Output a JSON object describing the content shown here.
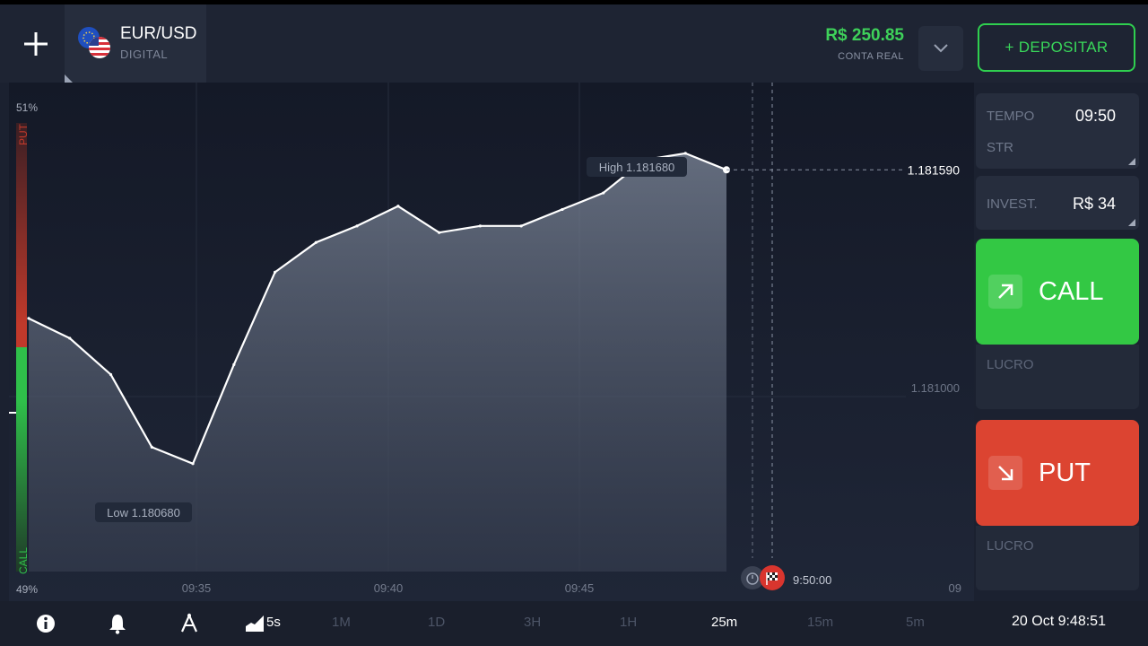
{
  "header": {
    "asset_name": "EUR/USD",
    "asset_type": "DIGITAL",
    "balance": "R$ 250.85",
    "account_label": "CONTA REAL",
    "deposit_label": "+ DEPOSITAR"
  },
  "chart": {
    "high_label": "High 1.181680",
    "low_label": "Low 1.180680",
    "current_price": "1.181590",
    "grid_price": "1.181000",
    "sentiment_top": "51%",
    "sentiment_bottom": "49%",
    "put_label": "PUT",
    "call_label": "CALL",
    "time_labels": [
      "09:35",
      "09:40",
      "09:45"
    ],
    "expiry_time": "9:50:00",
    "edge_label": "09"
  },
  "panel": {
    "time_label": "TEMPO",
    "time_value": "09:50",
    "time_sub": "STR",
    "invest_label": "INVEST.",
    "invest_value": "R$ 34",
    "call_label": "CALL",
    "put_label": "PUT",
    "profit_label": "LUCRO"
  },
  "bottom": {
    "candle_size": "5s",
    "timeframes": [
      "1M",
      "1D",
      "3H",
      "1H",
      "25m",
      "15m",
      "5m"
    ],
    "active_timeframe": "25m",
    "datetime": "20 Oct 9:48:51"
  },
  "colors": {
    "call": "#33c844",
    "put": "#dc4431",
    "balance": "#3ed15a",
    "background": "#1b2130"
  },
  "chart_data": {
    "type": "area",
    "x": [
      "09:31",
      "09:32",
      "09:33",
      "09:34",
      "09:35",
      "09:36",
      "09:37",
      "09:38",
      "09:39",
      "09:40",
      "09:41",
      "09:42",
      "09:43",
      "09:44",
      "09:45",
      "09:46",
      "09:47",
      "09:48"
    ],
    "series": [
      {
        "values": [
          1.18114,
          1.18108,
          1.18097,
          1.18075,
          1.1807,
          1.181,
          1.18128,
          1.18137,
          1.18142,
          1.18148,
          1.1814,
          1.18142,
          1.18142,
          1.18147,
          1.18152,
          1.18162,
          1.18164,
          1.18159
        ]
      }
    ],
    "annotations": [
      "High 1.181680",
      "Low 1.180680"
    ],
    "ylim": [
      1.18055,
      1.1818
    ]
  }
}
